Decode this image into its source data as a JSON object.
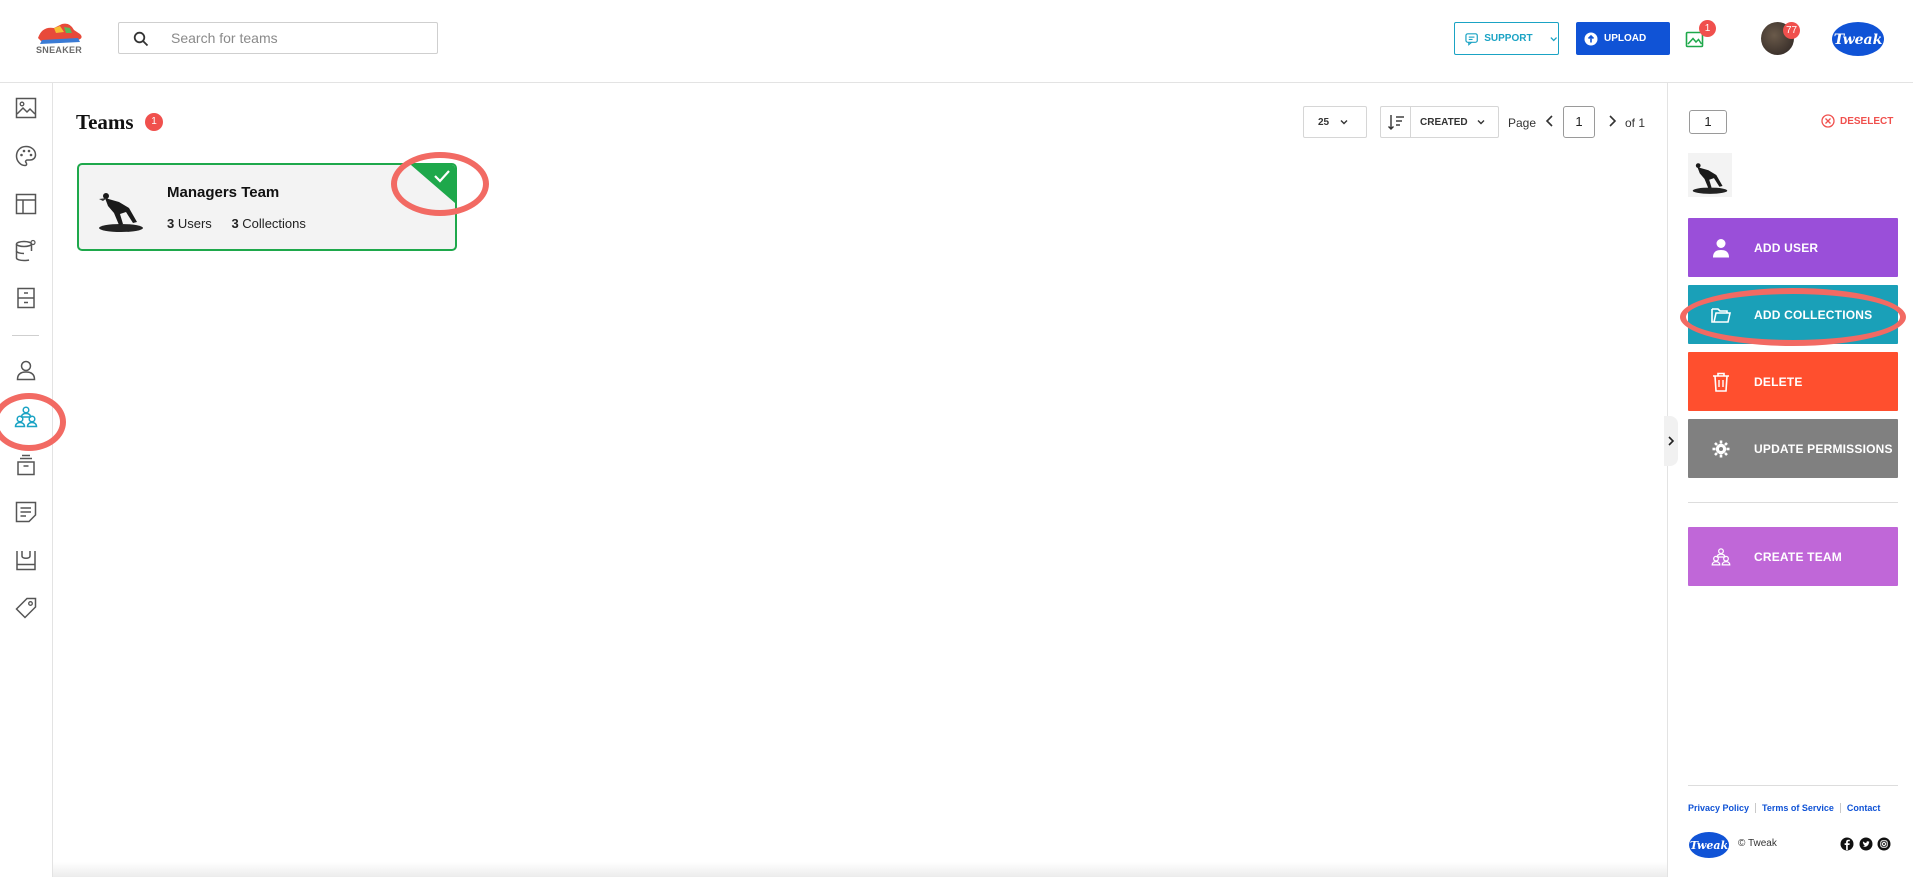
{
  "brand": {
    "logo_text": "SNEAKER",
    "partner_logo_text": "Tweak"
  },
  "search": {
    "placeholder": "Search for teams",
    "value": ""
  },
  "header": {
    "support_label": "SUPPORT",
    "upload_label": "UPLOAD",
    "gallery_badge": "1",
    "avatar_badge": "77"
  },
  "sidebar": {
    "items": [
      {
        "name": "images",
        "icon": "image-icon"
      },
      {
        "name": "palette",
        "icon": "palette-icon"
      },
      {
        "name": "layout",
        "icon": "layout-icon"
      },
      {
        "name": "data",
        "icon": "database-gear-icon"
      },
      {
        "name": "documents",
        "icon": "document-icon"
      },
      {
        "name": "users",
        "icon": "user-icon"
      },
      {
        "name": "teams",
        "icon": "team-icon",
        "active": true
      },
      {
        "name": "archive",
        "icon": "archive-icon"
      },
      {
        "name": "notes",
        "icon": "note-icon"
      },
      {
        "name": "store",
        "icon": "store-icon"
      },
      {
        "name": "tags",
        "icon": "tag-icon"
      }
    ]
  },
  "main": {
    "title": "Teams",
    "title_badge": "1",
    "per_page": "25",
    "sort_label": "CREATED",
    "pager": {
      "label": "Page",
      "current": "1",
      "of_label": "of 1"
    },
    "teams": [
      {
        "name": "Managers Team",
        "users_count": "3",
        "users_label": "Users",
        "collections_count": "3",
        "collections_label": "Collections",
        "selected": true
      }
    ]
  },
  "panel": {
    "selected_count": "1",
    "deselect_label": "DESELECT",
    "actions": {
      "add_user": "ADD USER",
      "add_collections": "ADD COLLECTIONS",
      "delete": "DELETE",
      "update_permissions": "UPDATE PERMISSIONS",
      "create_team": "CREATE TEAM"
    },
    "footer": {
      "privacy": "Privacy Policy",
      "terms": "Terms of Service",
      "contact": "Contact",
      "copyright": "© Tweak"
    }
  },
  "colors": {
    "accent_blue": "#1053d6",
    "support_teal": "#1aa3c4",
    "selected_green": "#1ea84b",
    "add_user": "#9a4fd9",
    "add_collections": "#1aa0b8",
    "delete": "#ff4f2e",
    "update_permissions": "#808080",
    "create_team": "#c067d8",
    "badge_red": "#f0504d",
    "highlight_ring": "#f26a63"
  }
}
